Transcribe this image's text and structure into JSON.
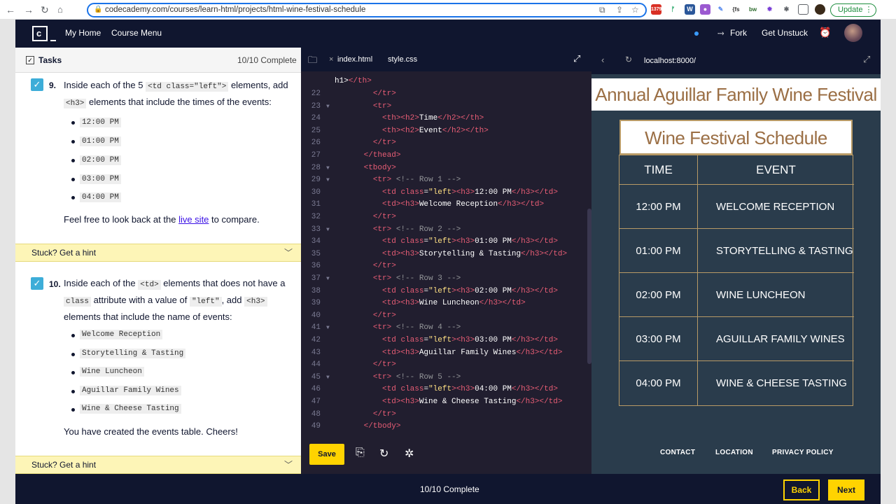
{
  "browser": {
    "url": "codecademy.com/courses/learn-html/projects/html-wine-festival-schedule",
    "update_label": "Update",
    "ext_badge": "1379"
  },
  "topbar": {
    "home": "My Home",
    "course_menu": "Course Menu",
    "fork": "Fork",
    "get_unstuck": "Get Unstuck"
  },
  "tasks": {
    "title": "Tasks",
    "progress": "10/10 Complete",
    "task9": {
      "number": "9.",
      "pre": "Inside each of the 5",
      "code1": "<td class=\"left\">",
      "mid": "elements, add",
      "code2": "<h3>",
      "post": "elements that include the times of the events:",
      "items": [
        "12:00 PM",
        "01:00 PM",
        "02:00 PM",
        "03:00 PM",
        "04:00 PM"
      ],
      "note_pre": "Feel free to look back at the",
      "note_link": "live site",
      "note_post": "to compare."
    },
    "hint1": "Stuck? Get a hint",
    "task10": {
      "number": "10.",
      "pre": "Inside each of the",
      "code1": "<td>",
      "mid": "elements that does not have a",
      "code2": "class",
      "mid2": "attribute with a value of",
      "code3": "\"left\"",
      "mid3": ", add",
      "code4": "<h3>",
      "post": "elements that include the name of events:",
      "items": [
        "Welcome Reception",
        "Storytelling & Tasting",
        "Wine Luncheon",
        "Aguillar Family Wines",
        "Wine & Cheese Tasting"
      ],
      "note": "You have created the events table. Cheers!"
    },
    "hint2": "Stuck? Get a hint"
  },
  "editor": {
    "tabs": [
      "index.html",
      "style.css"
    ],
    "save": "Save",
    "first_line": "h1></th>",
    "lines": [
      {
        "n": "22",
        "fold": "",
        "code": "        </tr>"
      },
      {
        "n": "23",
        "fold": "▼",
        "code": "        <tr>"
      },
      {
        "n": "24",
        "fold": "",
        "code": "          <th><h2>Time</h2></th>"
      },
      {
        "n": "25",
        "fold": "",
        "code": "          <th><h2>Event</h2></th>"
      },
      {
        "n": "26",
        "fold": "",
        "code": "        </tr>"
      },
      {
        "n": "27",
        "fold": "",
        "code": "      </thead>"
      },
      {
        "n": "28",
        "fold": "▼",
        "code": "      <tbody>"
      },
      {
        "n": "29",
        "fold": "▼",
        "code": "        <tr> <!-- Row 1 -->"
      },
      {
        "n": "30",
        "fold": "",
        "code": "          <td class=\"left\"><h3>12:00 PM</h3></td>"
      },
      {
        "n": "31",
        "fold": "",
        "code": "          <td><h3>Welcome Reception</h3></td>"
      },
      {
        "n": "32",
        "fold": "",
        "code": "        </tr>"
      },
      {
        "n": "33",
        "fold": "▼",
        "code": "        <tr> <!-- Row 2 -->"
      },
      {
        "n": "34",
        "fold": "",
        "code": "          <td class=\"left\"><h3>01:00 PM</h3></td>"
      },
      {
        "n": "35",
        "fold": "",
        "code": "          <td><h3>Storytelling & Tasting</h3></td>"
      },
      {
        "n": "36",
        "fold": "",
        "code": "        </tr>"
      },
      {
        "n": "37",
        "fold": "▼",
        "code": "        <tr> <!-- Row 3 -->"
      },
      {
        "n": "38",
        "fold": "",
        "code": "          <td class=\"left\"><h3>02:00 PM</h3></td>"
      },
      {
        "n": "39",
        "fold": "",
        "code": "          <td><h3>Wine Luncheon</h3></td>"
      },
      {
        "n": "40",
        "fold": "",
        "code": "        </tr>"
      },
      {
        "n": "41",
        "fold": "▼",
        "code": "        <tr> <!-- Row 4 -->"
      },
      {
        "n": "42",
        "fold": "",
        "code": "          <td class=\"left\"><h3>03:00 PM</h3></td>"
      },
      {
        "n": "43",
        "fold": "",
        "code": "          <td><h3>Aguillar Family Wines</h3></td>"
      },
      {
        "n": "44",
        "fold": "",
        "code": "        </tr>"
      },
      {
        "n": "45",
        "fold": "▼",
        "code": "        <tr> <!-- Row 5 -->"
      },
      {
        "n": "46",
        "fold": "",
        "code": "          <td class=\"left\"><h3>04:00 PM</h3></td>"
      },
      {
        "n": "47",
        "fold": "",
        "code": "          <td><h3>Wine & Cheese Tasting</h3></td>"
      },
      {
        "n": "48",
        "fold": "",
        "code": "        </tr>"
      },
      {
        "n": "49",
        "fold": "",
        "code": "      </tbody>"
      }
    ]
  },
  "preview": {
    "url": "localhost:8000/",
    "header": "Annual Aguillar Family Wine Festival",
    "table_title": "Wine Festival Schedule",
    "col_time": "TIME",
    "col_event": "EVENT",
    "rows": [
      {
        "time": "12:00 PM",
        "event": "WELCOME RECEPTION"
      },
      {
        "time": "01:00 PM",
        "event": "STORYTELLING & TASTING"
      },
      {
        "time": "02:00 PM",
        "event": "WINE LUNCHEON"
      },
      {
        "time": "03:00 PM",
        "event": "AGUILLAR FAMILY WINES"
      },
      {
        "time": "04:00 PM",
        "event": "WINE & CHEESE TASTING"
      }
    ],
    "footer": [
      "CONTACT",
      "LOCATION",
      "PRIVACY POLICY"
    ]
  },
  "bottom": {
    "status": "10/10 Complete",
    "back": "Back",
    "next": "Next"
  },
  "colors": {
    "brand_navy": "#10162f",
    "accent_yellow": "#ffd300",
    "wine_gold": "#9b6f45",
    "preview_bg": "#2a3c4c"
  }
}
